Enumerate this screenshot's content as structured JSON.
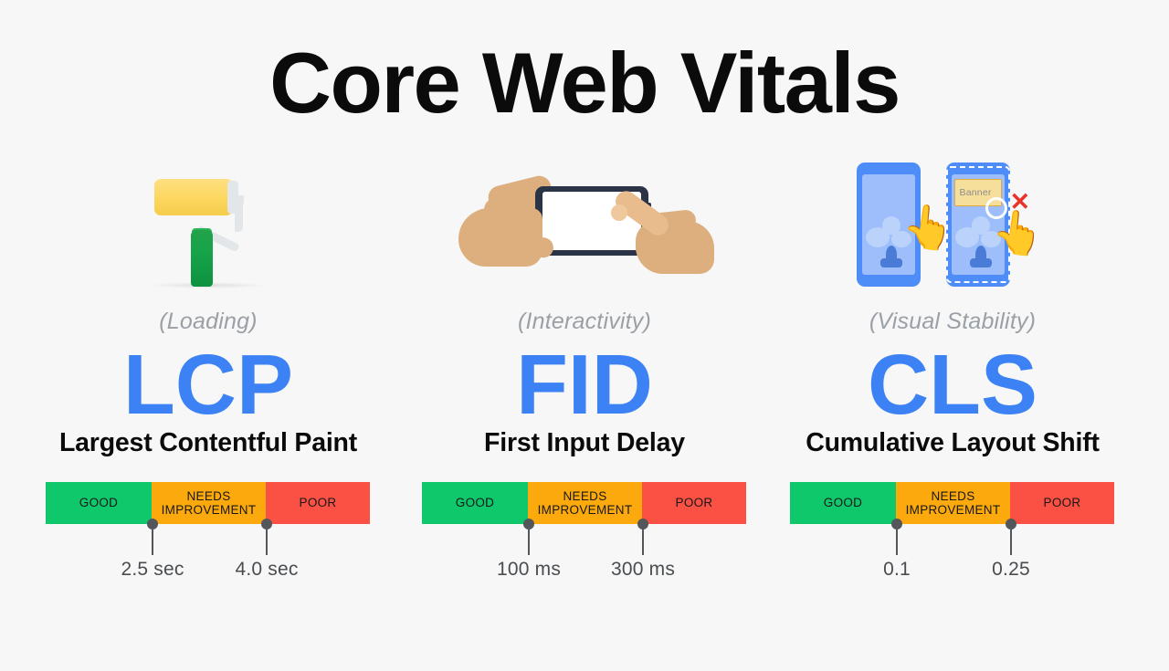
{
  "page": {
    "title": "Core Web Vitals",
    "background_color": "#F7F7F7"
  },
  "colors": {
    "accent_blue": "#3D82F5",
    "good_green": "#0FC86B",
    "needs_orange": "#FBA90C",
    "poor_red": "#FB5144",
    "subtitle_gray": "#9AA0A6",
    "marker_gray": "#53565A",
    "title_black": "#0B0B0B"
  },
  "bar_labels": {
    "good": "GOOD",
    "needs": "NEEDS IMPROVEMENT",
    "poor": "POOR"
  },
  "metrics": [
    {
      "icon": "paint-roller-icon",
      "subtitle": "(Loading)",
      "acronym": "LCP",
      "fullname": "Largest Contentful Paint",
      "threshold_good": "2.5 sec",
      "threshold_poor": "4.0 sec"
    },
    {
      "icon": "hands-tapping-phone-icon",
      "subtitle": "(Interactivity)",
      "acronym": "FID",
      "fullname": "First Input Delay",
      "threshold_good": "100 ms",
      "threshold_poor": "300 ms"
    },
    {
      "icon": "layout-shift-phones-icon",
      "subtitle": "(Visual Stability)",
      "acronym": "CLS",
      "fullname": "Cumulative Layout Shift",
      "threshold_good": "0.1",
      "threshold_poor": "0.25"
    }
  ],
  "cls_icon": {
    "banner_label": "Banner",
    "error_mark": "✕",
    "hand_glyph": "👆"
  },
  "chart_data": {
    "type": "bar",
    "title": "Core Web Vitals thresholds",
    "categories": [
      "GOOD",
      "NEEDS IMPROVEMENT",
      "POOR"
    ],
    "series": [
      {
        "name": "LCP",
        "unit": "sec",
        "boundaries": [
          2.5,
          4.0
        ],
        "boundary_labels": [
          "2.5 sec",
          "4.0 sec"
        ]
      },
      {
        "name": "FID",
        "unit": "ms",
        "boundaries": [
          100,
          300
        ],
        "boundary_labels": [
          "100 ms",
          "300 ms"
        ]
      },
      {
        "name": "CLS",
        "unit": "",
        "boundaries": [
          0.1,
          0.25
        ],
        "boundary_labels": [
          "0.1",
          "0.25"
        ]
      }
    ],
    "segment_colors": [
      "#0FC86B",
      "#FBA90C",
      "#FB5144"
    ],
    "legend": "position: inline segment labels",
    "grid": false
  }
}
